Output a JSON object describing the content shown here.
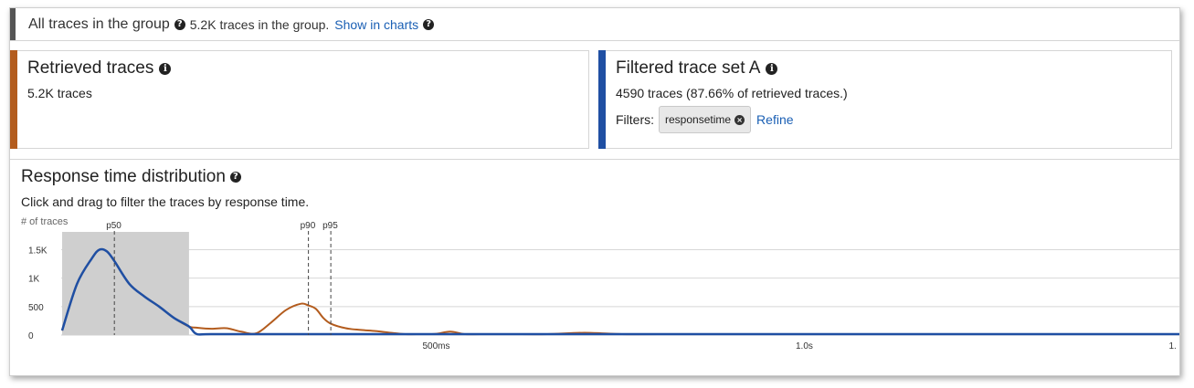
{
  "group_bar": {
    "title": "All traces in the group",
    "count_text": "5.2K traces in the group.",
    "show_in_charts": "Show in charts"
  },
  "retrieved": {
    "title": "Retrieved traces",
    "count_text": "5.2K traces",
    "accent_color": "#b35c1e"
  },
  "filtered": {
    "title": "Filtered trace set A",
    "count_text": "4590 traces (87.66% of retrieved traces.)",
    "filters_label": "Filters:",
    "filter_chip": "responsetime",
    "refine": "Refine",
    "accent_color": "#1f4fa3"
  },
  "distribution": {
    "title": "Response time distribution",
    "subtitle": "Click and drag to filter the traces by response time."
  },
  "chart_data": {
    "type": "area",
    "ylabel": "# of traces",
    "y_ticks": [
      "1.5K",
      "1K",
      "500",
      "0"
    ],
    "y_tick_values": [
      1500,
      1000,
      500,
      0
    ],
    "x_ticks": [
      "500ms",
      "1.0s",
      "1."
    ],
    "x_tick_values": [
      0.5,
      1.0,
      1.5
    ],
    "xlim": [
      0,
      1.5
    ],
    "ylim": [
      0,
      1700
    ],
    "percentiles": [
      {
        "name": "p50",
        "x": 0.07
      },
      {
        "name": "p90",
        "x": 0.33
      },
      {
        "name": "p95",
        "x": 0.36
      }
    ],
    "selection_range": [
      0,
      0.17
    ],
    "series": [
      {
        "name": "Retrieved traces",
        "color": "#b35c1e",
        "x": [
          0.0,
          0.02,
          0.04,
          0.05,
          0.06,
          0.07,
          0.09,
          0.11,
          0.13,
          0.15,
          0.17,
          0.18,
          0.2,
          0.22,
          0.24,
          0.26,
          0.28,
          0.3,
          0.32,
          0.33,
          0.34,
          0.35,
          0.36,
          0.38,
          0.4,
          0.42,
          0.44,
          0.46,
          0.48,
          0.5,
          0.52,
          0.54,
          0.56,
          0.6,
          0.65,
          0.7,
          0.75,
          0.8,
          1.0,
          1.2,
          1.5
        ],
        "values": [
          80,
          900,
          1350,
          1500,
          1470,
          1300,
          900,
          680,
          500,
          300,
          150,
          130,
          110,
          120,
          60,
          30,
          220,
          440,
          550,
          520,
          460,
          300,
          200,
          120,
          90,
          70,
          40,
          10,
          0,
          20,
          60,
          10,
          0,
          0,
          0,
          40,
          0,
          0,
          0,
          0,
          0
        ]
      },
      {
        "name": "Filtered trace set A",
        "color": "#1f4fa3",
        "x": [
          0.0,
          0.02,
          0.04,
          0.05,
          0.06,
          0.07,
          0.09,
          0.11,
          0.13,
          0.15,
          0.17,
          0.18,
          0.2,
          0.3,
          0.5,
          1.0,
          1.5
        ],
        "values": [
          80,
          900,
          1350,
          1500,
          1470,
          1300,
          900,
          680,
          500,
          300,
          150,
          20,
          0,
          0,
          0,
          0,
          0
        ]
      }
    ]
  }
}
